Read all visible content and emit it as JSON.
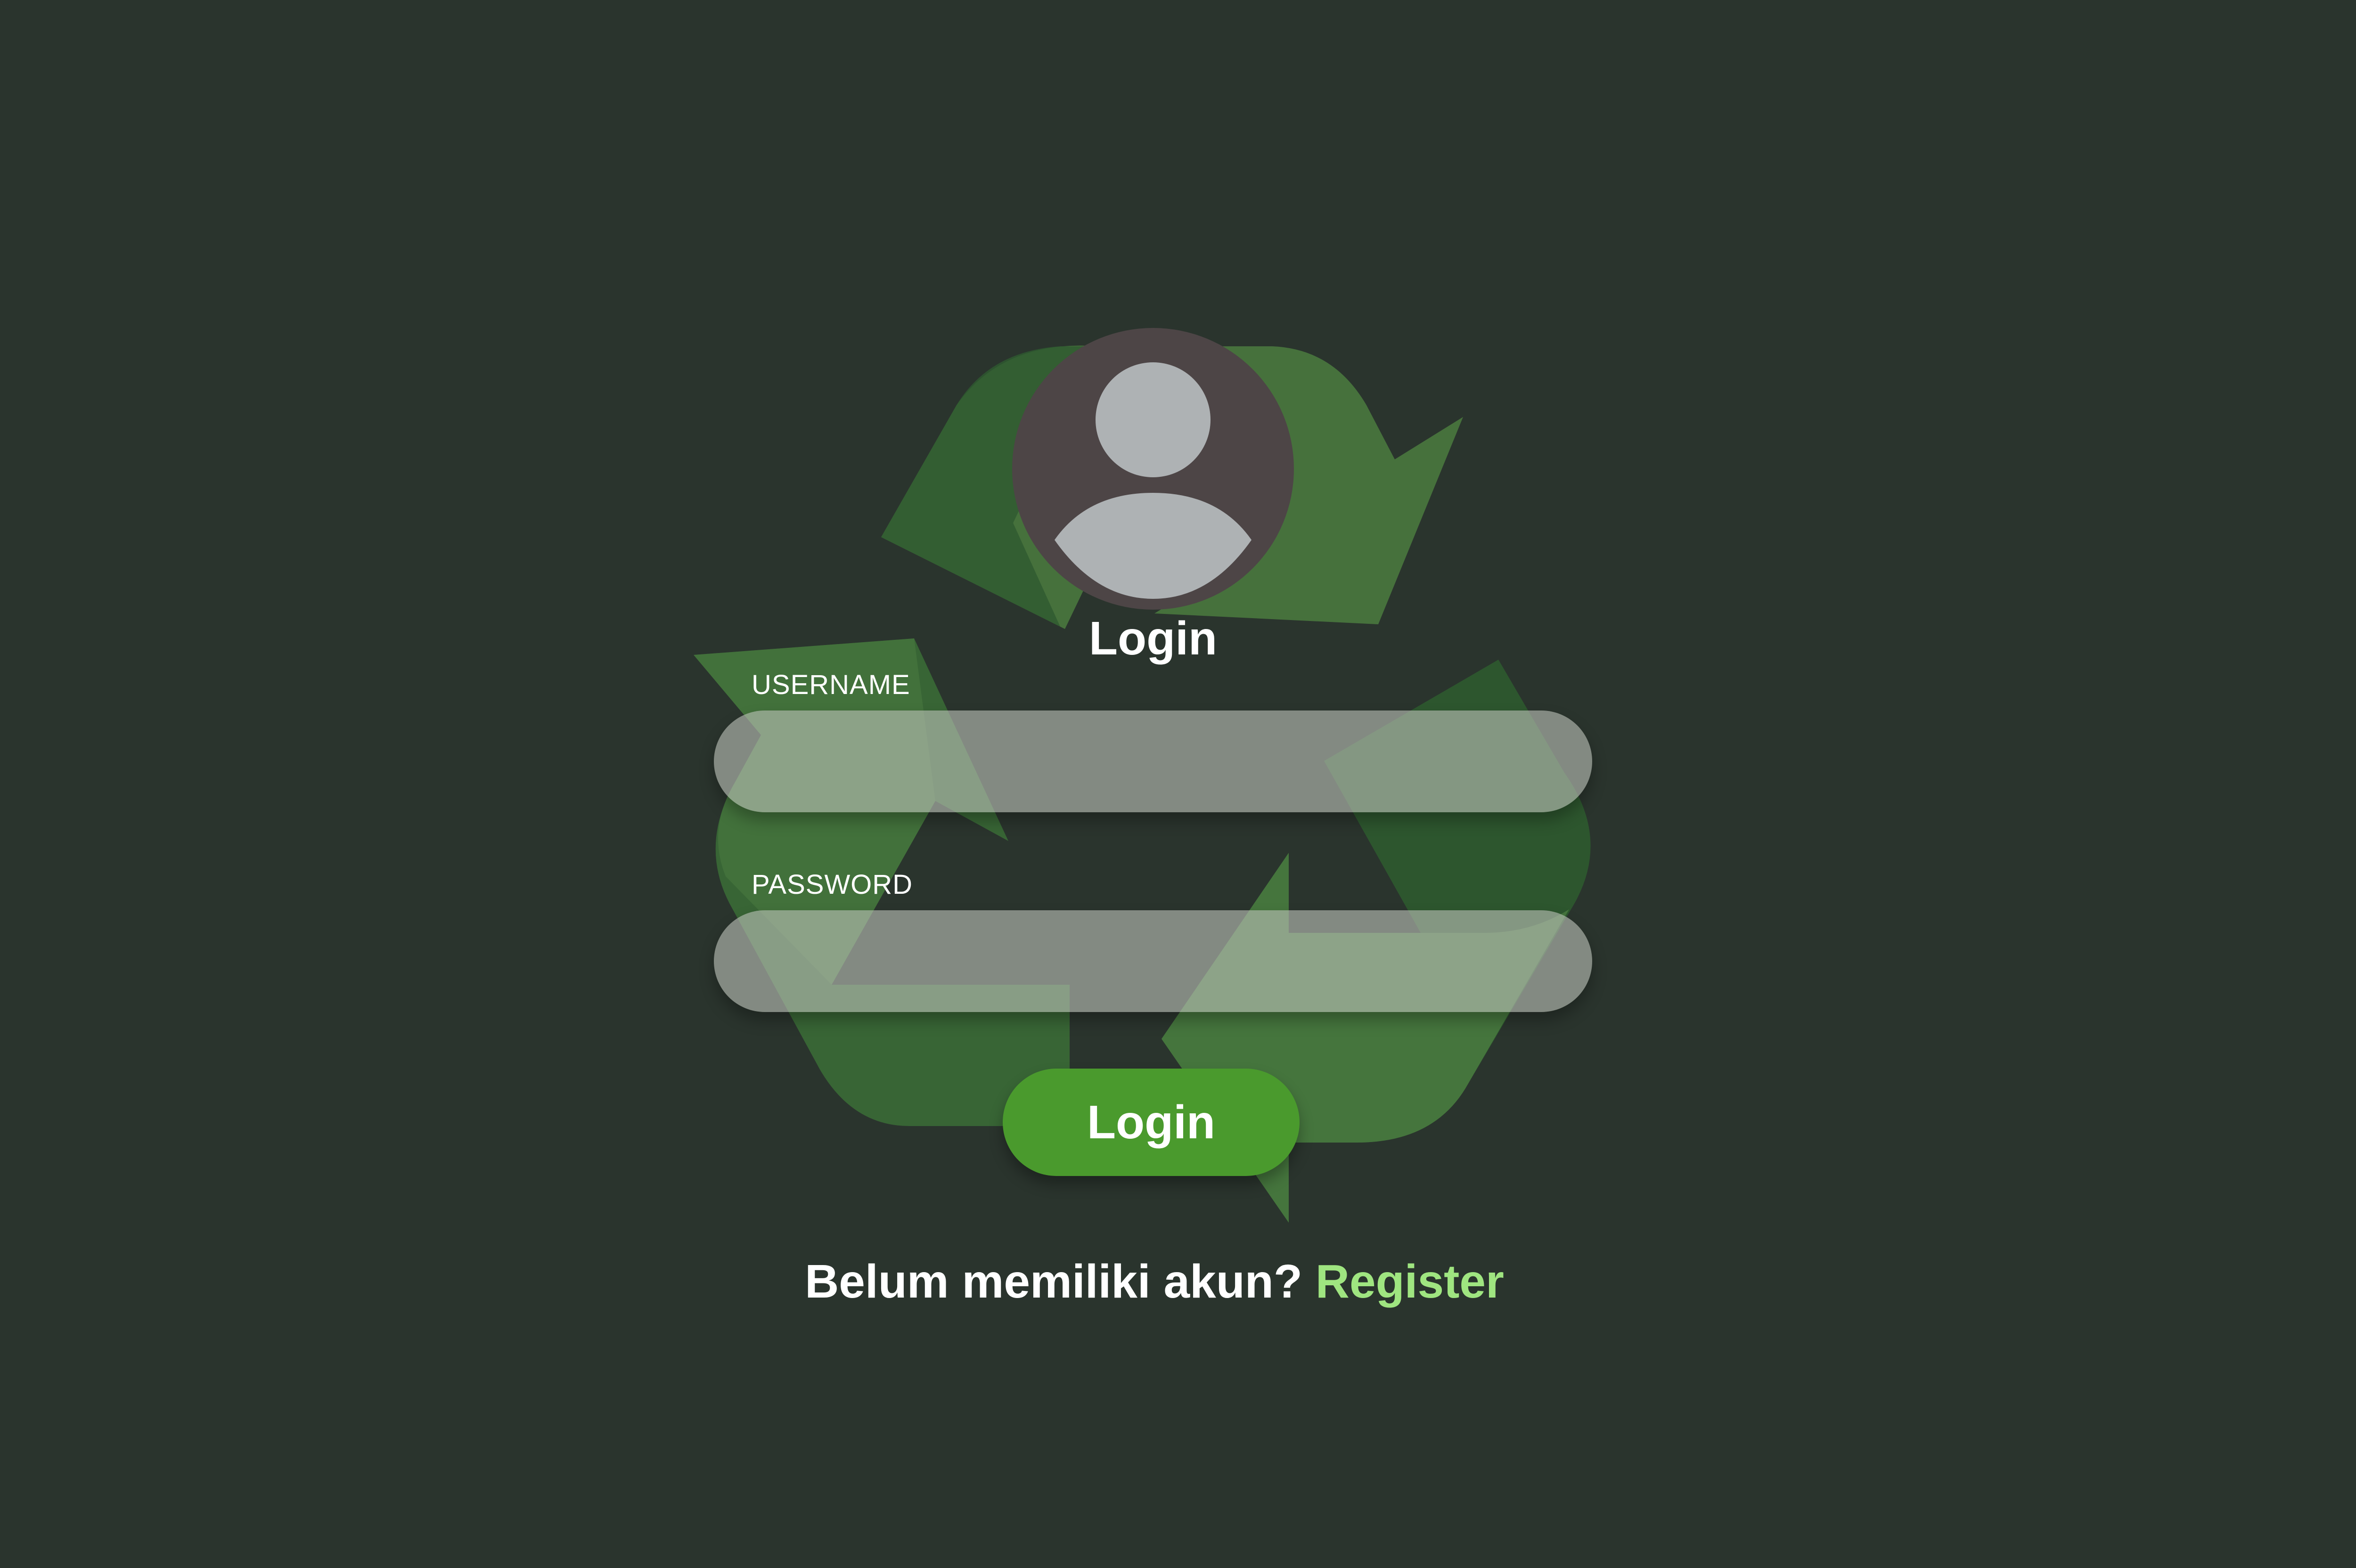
{
  "colors": {
    "background": "#2a342d",
    "recycle_arrows": [
      "#2e5a2f",
      "#4a7a3f",
      "#3a6a36"
    ],
    "avatar_bg": "#4d4546",
    "avatar_figure": "#aeb2b4",
    "input_bg": "#b9c0b6",
    "button_bg": "#4a9a2d",
    "register_link": "#9fe580"
  },
  "background_logo": {
    "icon": "recycle-icon"
  },
  "avatar": {
    "icon": "user-avatar-icon"
  },
  "form": {
    "title": "Login",
    "username": {
      "label": "USERNAME",
      "value": "",
      "placeholder": ""
    },
    "password": {
      "label": "PASSWORD",
      "value": "",
      "placeholder": ""
    },
    "submit_label": "Login"
  },
  "footer": {
    "prompt": "Belum memiliki akun?",
    "register_label": "Register"
  }
}
